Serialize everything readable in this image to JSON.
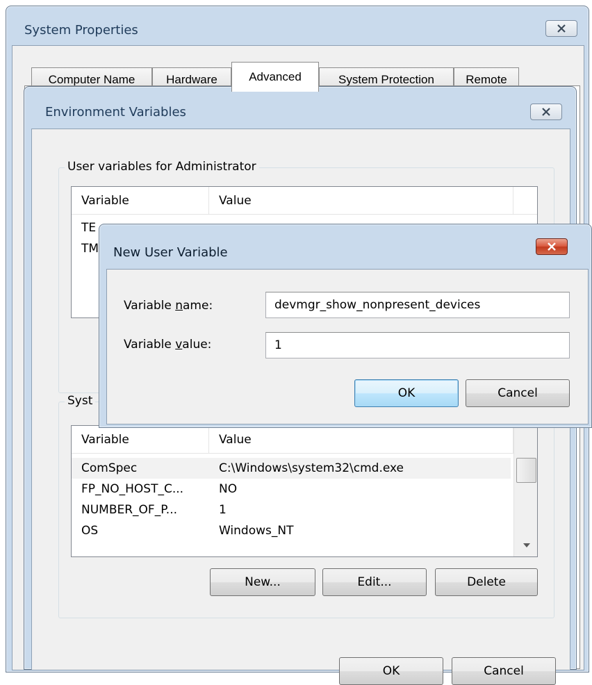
{
  "system_properties": {
    "title": "System Properties",
    "tabs": [
      "Computer Name",
      "Hardware",
      "Advanced",
      "System Protection",
      "Remote"
    ],
    "active_tab": "Advanced"
  },
  "env_vars": {
    "title": "Environment Variables",
    "user_group_label": "User variables for Administrator",
    "user_columns": [
      "Variable",
      "Value"
    ],
    "user_rows_visible": [
      "TE",
      "TM"
    ],
    "system_group_label": "Syst",
    "system_columns": [
      "Variable",
      "Value"
    ],
    "system_rows": [
      {
        "variable": "ComSpec",
        "value": "C:\\Windows\\system32\\cmd.exe"
      },
      {
        "variable": "FP_NO_HOST_C...",
        "value": "NO"
      },
      {
        "variable": "NUMBER_OF_P...",
        "value": "1"
      },
      {
        "variable": "OS",
        "value": "Windows_NT"
      }
    ],
    "new_label": "New...",
    "edit_label": "Edit...",
    "delete_label": "Delete",
    "ok_label": "OK",
    "cancel_label": "Cancel"
  },
  "new_var": {
    "title": "New User Variable",
    "name_label_pre": "Variable ",
    "name_label_access": "n",
    "name_label_post": "ame:",
    "name_value": "devmgr_show_nonpresent_devices",
    "value_label_pre": "Variable ",
    "value_label_access": "v",
    "value_label_post": "alue:",
    "value_value": "1",
    "ok_label": "OK",
    "cancel_label": "Cancel"
  }
}
